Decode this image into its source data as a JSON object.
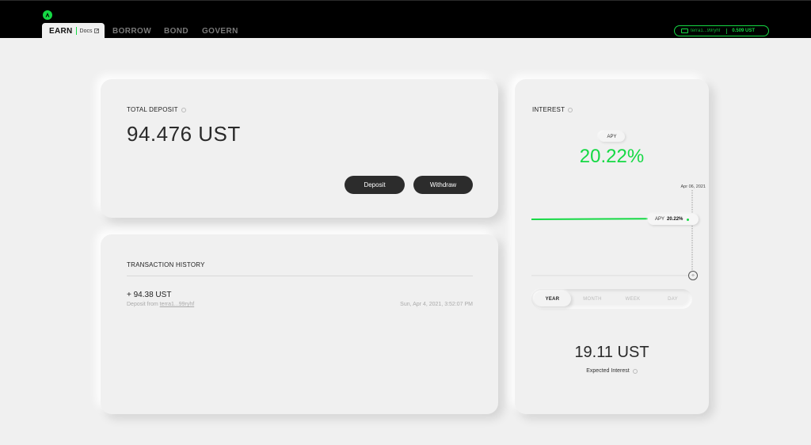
{
  "header": {
    "nav": [
      {
        "label": "EARN",
        "active": true
      },
      {
        "label": "BORROW",
        "active": false
      },
      {
        "label": "BOND",
        "active": false
      },
      {
        "label": "GOVERN",
        "active": false
      }
    ],
    "docs_label": "Docs",
    "wallet": {
      "address": "terra1...99ryhf",
      "balance": "0.509 UST"
    }
  },
  "deposit": {
    "title": "TOTAL DEPOSIT",
    "amount": "94.476 UST",
    "deposit_label": "Deposit",
    "withdraw_label": "Withdraw"
  },
  "history": {
    "title": "TRANSACTION HISTORY",
    "transactions": [
      {
        "amount": "+ 94.38 UST",
        "desc_prefix": "Deposit from",
        "address": "terra1...99ryhf",
        "date": "Sun, Apr 4, 2021, 3:52:07 PM"
      }
    ]
  },
  "interest": {
    "title": "INTEREST",
    "apy_label": "APY",
    "apy_value": "20.22%",
    "chart_date": "Apr 06, 2021",
    "tooltip_label": "APY",
    "tooltip_value": "20.22%",
    "periods": [
      "YEAR",
      "MONTH",
      "WEEK",
      "DAY"
    ],
    "selected_period": "YEAR",
    "expected_value": "19.11 UST",
    "expected_label": "Expected Interest"
  },
  "colors": {
    "accent": "#15d944",
    "background": "#f0f0f0",
    "header": "#000000",
    "button": "#2c2c2c"
  }
}
